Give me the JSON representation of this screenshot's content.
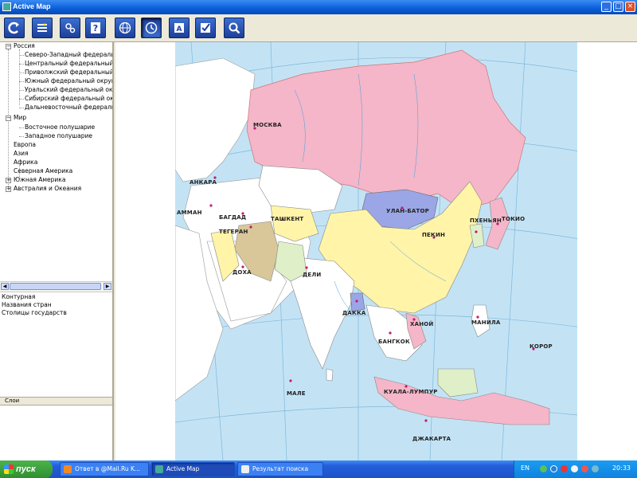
{
  "window": {
    "title": "Active Map",
    "minimize": "_",
    "maximize": "□",
    "close": "×"
  },
  "toolbar": {
    "buttons": [
      {
        "name": "refresh-icon"
      },
      {
        "name": "layers-icon"
      },
      {
        "name": "settings-icon"
      },
      {
        "name": "help-icon"
      },
      {
        "name": "globe-icon"
      },
      {
        "name": "clock-icon"
      },
      {
        "name": "book-icon"
      },
      {
        "name": "check-icon"
      },
      {
        "name": "search-icon"
      }
    ]
  },
  "tree": {
    "russia": "Россия",
    "russia_children": [
      "Северо-Западный федеральный",
      "Центральный федеральный ок",
      "Приволжский федеральный ок",
      "Южный федеральный округ",
      "Уральский федеральный окру",
      "Сибирский федеральный окру",
      "Дальневосточный федеральный"
    ],
    "world": "Мир",
    "world_children": [
      "Восточное полушарие",
      "Западное полушарие"
    ],
    "europe": "Европа",
    "asia": "Азия",
    "africa": "Африка",
    "north_america": "Северная Америка",
    "south_america": "Южная Америка",
    "australia": "Австралия и Океания"
  },
  "layers": {
    "items": [
      "Контурная",
      "Названия стран",
      "Столицы государств"
    ]
  },
  "splitter": {
    "label": "Слои"
  },
  "map": {
    "labels": {
      "moscow": "МОСКВА",
      "ankara": "АНКАРА",
      "amman": "АММАН",
      "baghdad": "БАГДАД",
      "tehran": "ТЕГЕРАН",
      "tashkent": "ТАШКЕНТ",
      "ulanbator": "УЛАН-БАТОР",
      "pekin": "ПЕКИН",
      "phenyan": "ПХЕНЬЯН",
      "tokio": "ТОКИО",
      "doha": "ДОХА",
      "delhi": "ДЕЛИ",
      "dhaka": "ДАККА",
      "bangkok": "БАНГКОК",
      "hanoi": "ХАНОЙ",
      "manila": "МАНИЛА",
      "male": "МАЛЕ",
      "kuala": "КУАЛА-ЛУМПУР",
      "jakarta": "ДЖАКАРТА",
      "koror": "КОРОР"
    }
  },
  "taskbar": {
    "start": "пуск",
    "tasks": [
      "Ответ в @Mail.Ru K...",
      "Active Map",
      "Результат поиска"
    ],
    "lang": "EN",
    "clock": "20:33"
  },
  "colors": {
    "russia": "#f4b6c8",
    "china": "#fff4a8",
    "mongolia": "#9aa6e6",
    "ocean": "#c3e3f5",
    "land": "#ffffff"
  }
}
